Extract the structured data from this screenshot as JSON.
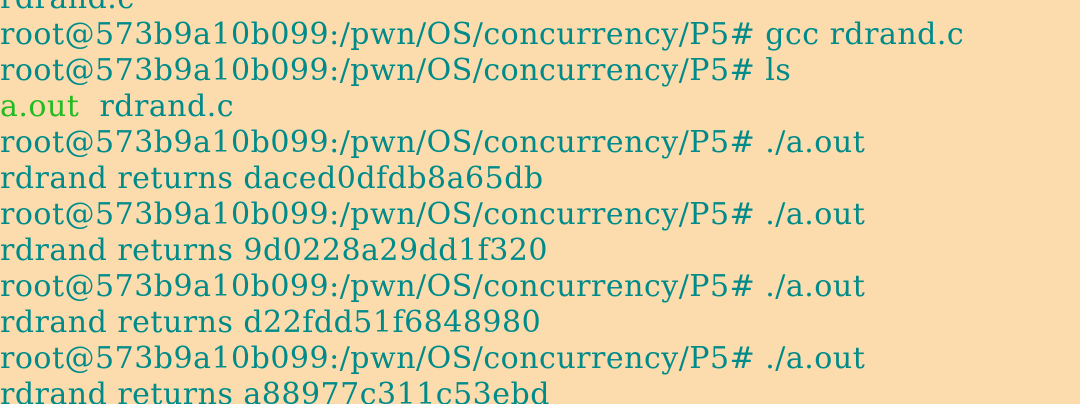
{
  "terminal": {
    "partial_top_line": "rdrand.c",
    "lines": [
      {
        "kind": "prompt",
        "text": "root@573b9a10b099:/pwn/OS/concurrency/P5# gcc rdrand.c"
      },
      {
        "kind": "prompt",
        "text": "root@573b9a10b099:/pwn/OS/concurrency/P5# ls"
      },
      {
        "kind": "ls",
        "files": [
          {
            "name": "a.out",
            "type": "executable"
          },
          {
            "name": "rdrand.c",
            "type": "regular"
          }
        ]
      },
      {
        "kind": "prompt",
        "text": "root@573b9a10b099:/pwn/OS/concurrency/P5# ./a.out"
      },
      {
        "kind": "output",
        "text": "rdrand returns daced0dfdb8a65db"
      },
      {
        "kind": "prompt",
        "text": "root@573b9a10b099:/pwn/OS/concurrency/P5# ./a.out"
      },
      {
        "kind": "output",
        "text": "rdrand returns 9d0228a29dd1f320"
      },
      {
        "kind": "prompt",
        "text": "root@573b9a10b099:/pwn/OS/concurrency/P5# ./a.out"
      },
      {
        "kind": "output",
        "text": "rdrand returns d22fdd51f6848980"
      },
      {
        "kind": "prompt",
        "text": "root@573b9a10b099:/pwn/OS/concurrency/P5# ./a.out"
      },
      {
        "kind": "output",
        "text": "rdrand returns a88977c311c53ebd"
      }
    ]
  },
  "colors": {
    "background": "#fcdcac",
    "text": "#008b8b",
    "executable": "#22bb22"
  }
}
